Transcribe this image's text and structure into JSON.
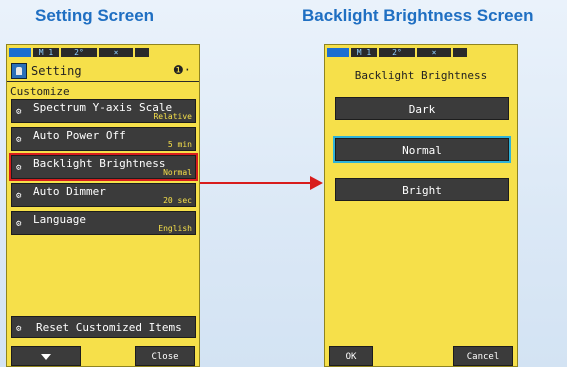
{
  "captions": {
    "left": "Setting Screen",
    "right": "Backlight Brightness Screen"
  },
  "statusbar": {
    "mode": "M 1",
    "angle": "2°",
    "extra": "×"
  },
  "setting": {
    "title": "Setting",
    "info_glyph": "❶·",
    "section": "Customize",
    "items": [
      {
        "label": "Spectrum Y-axis Scale",
        "value": "Relative"
      },
      {
        "label": "Auto Power Off",
        "value": "5 min"
      },
      {
        "label": "Backlight Brightness",
        "value": "Normal"
      },
      {
        "label": "Auto Dimmer",
        "value": "20 sec"
      },
      {
        "label": "Language",
        "value": "English"
      }
    ],
    "reset_label": "Reset Customized Items",
    "close_label": "Close"
  },
  "backlight": {
    "title": "Backlight Brightness",
    "options": [
      "Dark",
      "Normal",
      "Bright"
    ],
    "selected": "Normal",
    "ok_label": "OK",
    "cancel_label": "Cancel"
  },
  "colors": {
    "screen_bg": "#f6e04a",
    "button_bg": "#3b3b3b",
    "highlight_red": "#d81d1d",
    "highlight_cyan": "#2fb3d8",
    "caption_blue": "#1f6fc2"
  },
  "icons": {
    "gear": "gear-icon",
    "setting": "setting-icon",
    "battery": "battery-icon",
    "down": "down-arrow-icon"
  }
}
